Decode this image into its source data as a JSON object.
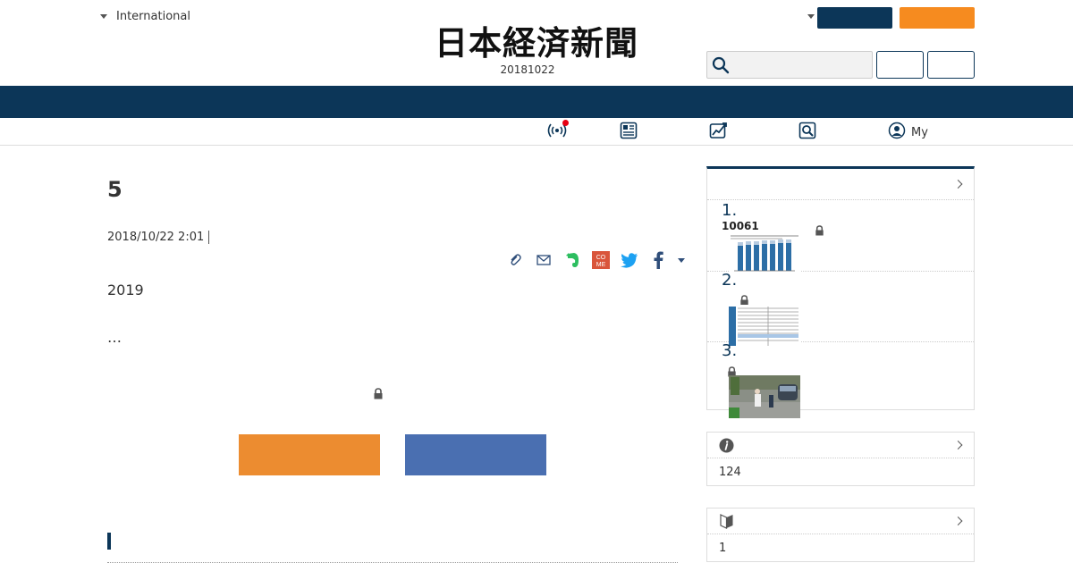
{
  "header": {
    "region_label": "International",
    "logo_text": "日本経済新聞",
    "edition_date": "20181022",
    "search_placeholder": ""
  },
  "subnav": {
    "my_label": "My"
  },
  "article": {
    "title": "5",
    "datetime": "2018/10/22 2:01",
    "lead": "2019",
    "ellipsis": "…"
  },
  "ranking": {
    "items": [
      {
        "rank": "1.",
        "label": "10061"
      },
      {
        "rank": "2.",
        "label": ""
      },
      {
        "rank": "3.",
        "label": ""
      }
    ]
  },
  "info_box": {
    "value": "124"
  },
  "beginner_box": {
    "value": "1"
  },
  "colors": {
    "navy": "#0c3658",
    "orange": "#f68b1f",
    "cta_orange": "#ec8c30",
    "cta_blue": "#4a6fb1",
    "notification_red": "#e60012"
  },
  "icons": {
    "search": "search-icon",
    "live": "live-broadcast-icon",
    "newspaper": "newspaper-icon",
    "market": "market-chart-icon",
    "search_news": "news-search-icon",
    "my": "user-icon",
    "clip": "clip-icon",
    "mail": "mail-icon",
    "evernote": "evernote-icon",
    "comemo": "comemo-icon",
    "twitter": "twitter-icon",
    "facebook": "facebook-icon",
    "lock": "lock-icon",
    "info": "info-icon",
    "beginner": "beginner-leaf-icon"
  }
}
